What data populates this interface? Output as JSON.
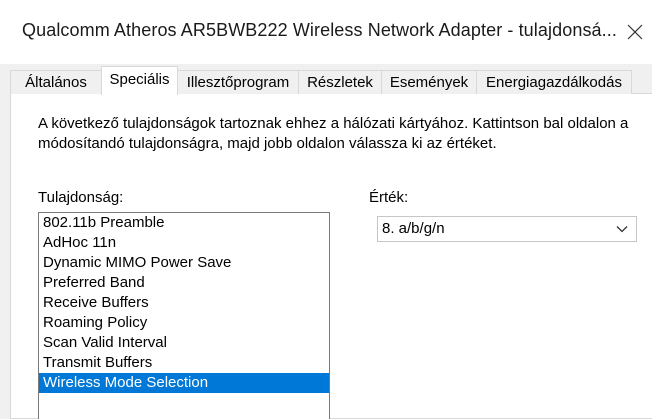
{
  "window": {
    "title": "Qualcomm Atheros AR5BWB222 Wireless Network Adapter - tulajdonsá...",
    "close_icon": "close-icon"
  },
  "tabs": [
    {
      "label": "Általános"
    },
    {
      "label": "Speciális",
      "active": true
    },
    {
      "label": "Illesztőprogram"
    },
    {
      "label": "Részletek"
    },
    {
      "label": "Események"
    },
    {
      "label": "Energiagazdálkodás"
    }
  ],
  "description": "A következő tulajdonságok tartoznak ehhez a hálózati kártyához. Kattintson bal oldalon a módosítandó tulajdonságra, majd jobb oldalon válassza ki az értéket.",
  "property": {
    "label": "Tulajdonság:",
    "items": [
      "802.11b Preamble",
      "AdHoc 11n",
      "Dynamic MIMO Power Save",
      "Preferred Band",
      "Receive Buffers",
      "Roaming Policy",
      "Scan Valid Interval",
      "Transmit Buffers",
      "Wireless Mode Selection"
    ],
    "selected_index": 8
  },
  "value": {
    "label": "Érték:",
    "selected": "8. a/b/g/n",
    "chevron_icon": "chevron-down-icon"
  },
  "colors": {
    "selection": "#0078d7",
    "dialog_bg": "#f0f0f0"
  }
}
